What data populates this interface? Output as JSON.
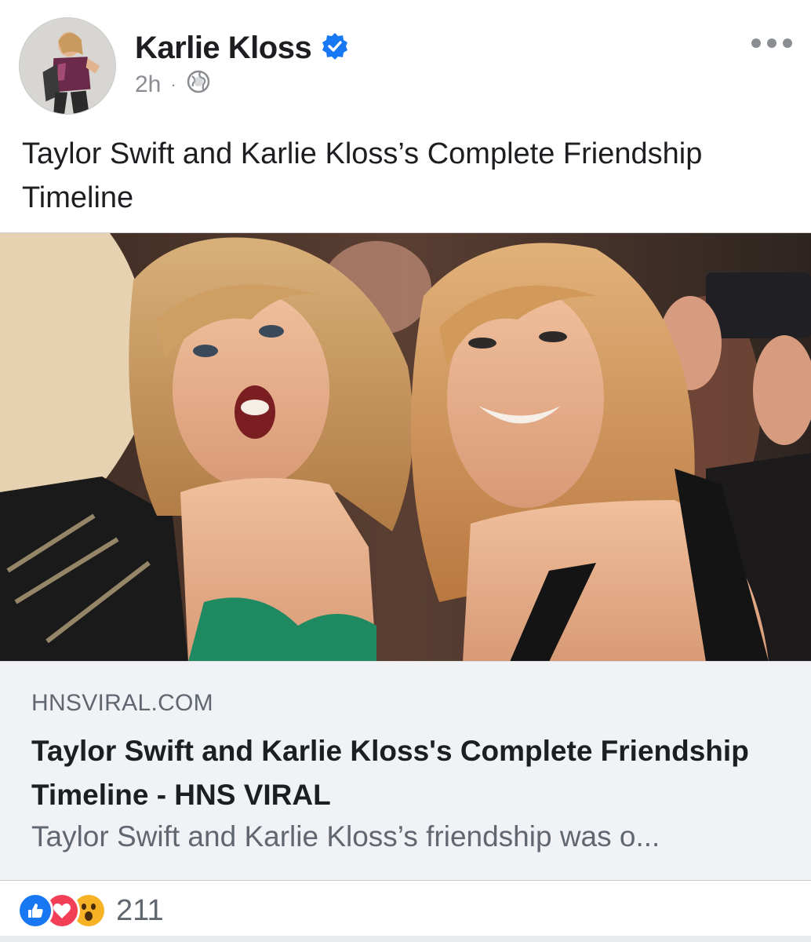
{
  "post": {
    "author": {
      "name": "Karlie Kloss",
      "verified_icon": "verified-badge-icon",
      "avatar": "profile-photo"
    },
    "meta": {
      "time": "2h",
      "separator": "·",
      "audience_icon": "globe-icon"
    },
    "more_icon": "more-options-icon",
    "caption": "Taylor Swift and Karlie Kloss’s Complete Friendship Timeline",
    "image": "photo of two smiling women seated in a crowd"
  },
  "link_preview": {
    "domain": "HNSVIRAL.COM",
    "title": "Taylor Swift and Karlie Kloss's Complete Friendship Timeline - HNS VIRAL",
    "description": "Taylor Swift and Karlie Kloss’s friendship was o..."
  },
  "reactions": {
    "icons": [
      "like-reaction-icon",
      "love-reaction-icon",
      "wow-reaction-icon"
    ],
    "count": "211"
  },
  "colors": {
    "verified_blue": "#1877f2",
    "like_blue": "#1877f2",
    "love_red": "#f33e58",
    "wow_yellow": "#f7b125",
    "secondary_text": "#606770",
    "link_background": "#f0f2f5"
  }
}
